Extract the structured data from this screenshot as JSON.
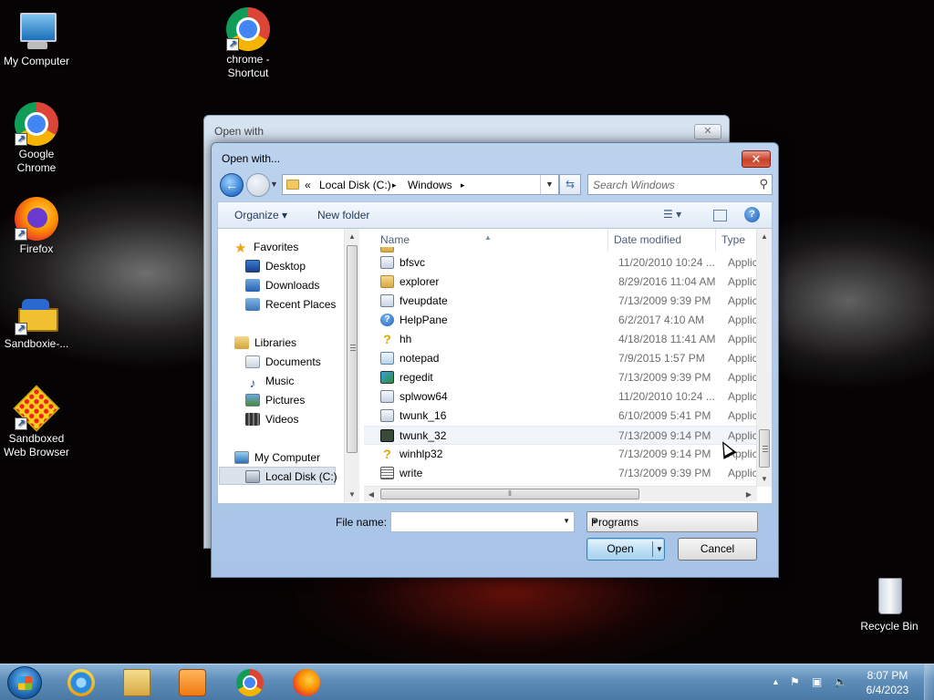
{
  "desktop": {
    "icons": [
      {
        "label": "My Computer"
      },
      {
        "label": "chrome - Shortcut"
      },
      {
        "label": "Google Chrome"
      },
      {
        "label": "Firefox"
      },
      {
        "label": "Sandboxie-..."
      },
      {
        "label": "Sandboxed Web Browser"
      },
      {
        "label": "Recycle Bin"
      }
    ]
  },
  "bg_window": {
    "title": "Open with",
    "close_glyph": "✕"
  },
  "dialog": {
    "title": "Open with...",
    "close_glyph": "✕",
    "address": {
      "prefix": "«",
      "crumbs": [
        "Local Disk (C:)",
        "Windows"
      ],
      "sep": "▸"
    },
    "search_placeholder": "Search Windows",
    "toolbar": {
      "organize_label": "Organize ▾",
      "new_folder_label": "New folder"
    },
    "nav": {
      "favorites": "Favorites",
      "desktop": "Desktop",
      "downloads": "Downloads",
      "recent_places": "Recent Places",
      "libraries": "Libraries",
      "documents": "Documents",
      "music": "Music",
      "pictures": "Pictures",
      "videos": "Videos",
      "my_computer": "My Computer",
      "local_disk": "Local Disk (C:)"
    },
    "columns": {
      "name": "Name",
      "date_modified": "Date modified",
      "type": "Type"
    },
    "files": [
      {
        "name": "bfsvc",
        "date": "11/20/2010 10:24 ...",
        "type": "Applic",
        "icon": "exe-icon"
      },
      {
        "name": "explorer",
        "date": "8/29/2016 11:04 AM",
        "type": "Applic",
        "icon": "folder-icon"
      },
      {
        "name": "fveupdate",
        "date": "7/13/2009 9:39 PM",
        "type": "Applic",
        "icon": "exe-icon"
      },
      {
        "name": "HelpPane",
        "date": "6/2/2017 4:10 AM",
        "type": "Applic",
        "icon": "help-icon"
      },
      {
        "name": "hh",
        "date": "4/18/2018 11:41 AM",
        "type": "Applic",
        "icon": "help-file-icon"
      },
      {
        "name": "notepad",
        "date": "7/9/2015 1:57 PM",
        "type": "Applic",
        "icon": "notepad-icon"
      },
      {
        "name": "regedit",
        "date": "7/13/2009 9:39 PM",
        "type": "Applic",
        "icon": "regedit-icon"
      },
      {
        "name": "splwow64",
        "date": "11/20/2010 10:24 ...",
        "type": "Applic",
        "icon": "exe-icon"
      },
      {
        "name": "twunk_16",
        "date": "6/10/2009 5:41 PM",
        "type": "Applic",
        "icon": "exe-icon"
      },
      {
        "name": "twunk_32",
        "date": "7/13/2009 9:14 PM",
        "type": "Applic",
        "icon": "scanner-icon"
      },
      {
        "name": "winhlp32",
        "date": "7/13/2009 9:14 PM",
        "type": "Applic",
        "icon": "help-file-icon"
      },
      {
        "name": "write",
        "date": "7/13/2009 9:39 PM",
        "type": "Applic",
        "icon": "write-icon"
      }
    ],
    "file_name_label": "File name:",
    "file_name_value": "",
    "file_type_selected": "Programs",
    "open_label": "Open",
    "cancel_label": "Cancel"
  },
  "taskbar": {
    "apps": [
      "start-button",
      "internet-explorer",
      "windows-explorer",
      "media-player",
      "google-chrome",
      "firefox"
    ],
    "time": "8:07 PM",
    "date": "6/4/2023"
  },
  "colors": {
    "dialog_frame": "#a7c3e6",
    "taskbar": "#5d8db8",
    "close_red": "#c8412b"
  }
}
